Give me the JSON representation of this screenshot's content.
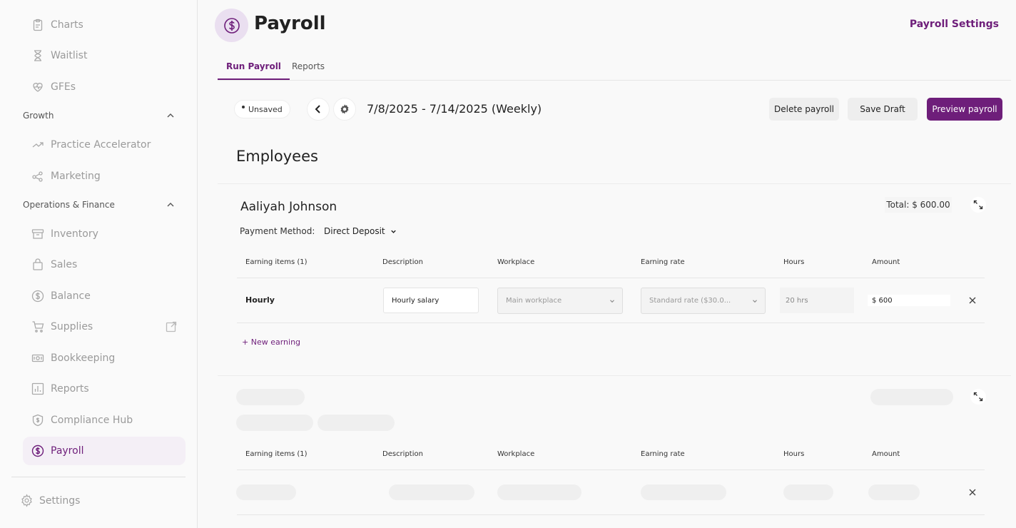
{
  "sidebar": {
    "items": [
      {
        "label": "Charts",
        "icon": "clipboard-icon"
      },
      {
        "label": "Waitlist",
        "icon": "hourglass-icon"
      },
      {
        "label": "GFEs",
        "icon": "heart-icon"
      }
    ],
    "groups": [
      {
        "label": "Growth",
        "items": [
          {
            "label": "Practice Accelerator",
            "icon": "trend-icon"
          },
          {
            "label": "Marketing",
            "icon": "share-icon"
          }
        ]
      },
      {
        "label": "Operations & Finance",
        "items": [
          {
            "label": "Inventory",
            "icon": "archive-icon"
          },
          {
            "label": "Sales",
            "icon": "bag-icon"
          },
          {
            "label": "Balance",
            "icon": "dollar-icon"
          },
          {
            "label": "Supplies",
            "icon": "cart-icon"
          },
          {
            "label": "Bookkeeping",
            "icon": "money-icon"
          },
          {
            "label": "Reports",
            "icon": "chart-icon"
          },
          {
            "label": "Compliance Hub",
            "icon": "shield-icon"
          },
          {
            "label": "Payroll",
            "icon": "dollar-circle-icon"
          }
        ]
      }
    ],
    "settings": "Settings",
    "accent": "#6e1e7a"
  },
  "header": {
    "title": "Payroll",
    "settings_link": "Payroll Settings"
  },
  "tabs": [
    {
      "label": "Run Payroll",
      "active": true
    },
    {
      "label": "Reports",
      "active": false
    }
  ],
  "toolbar": {
    "unsaved": "Unsaved",
    "period": "7/8/2025 - 7/14/2025 (Weekly)",
    "delete_label": "Delete payroll",
    "save_label": "Save Draft",
    "preview_label": "Preview payroll"
  },
  "employees": {
    "heading": "Employees",
    "columns": [
      "Earning items (1)",
      "Description",
      "Workplace",
      "Earning rate",
      "Hours",
      "Amount"
    ],
    "first": {
      "name": "Aaliyah Johnson",
      "total": "Total: $ 600.00",
      "payment_method_label": "Payment Method:",
      "payment_method": "Direct Deposit",
      "earning": {
        "item": "Hourly",
        "description": "Hourly salary",
        "workplace": "Main workplace",
        "rate": "Standard rate ($30.0...",
        "hours": "20 hrs",
        "amount": "$ 600"
      },
      "new_earning": "+ New earning"
    }
  }
}
